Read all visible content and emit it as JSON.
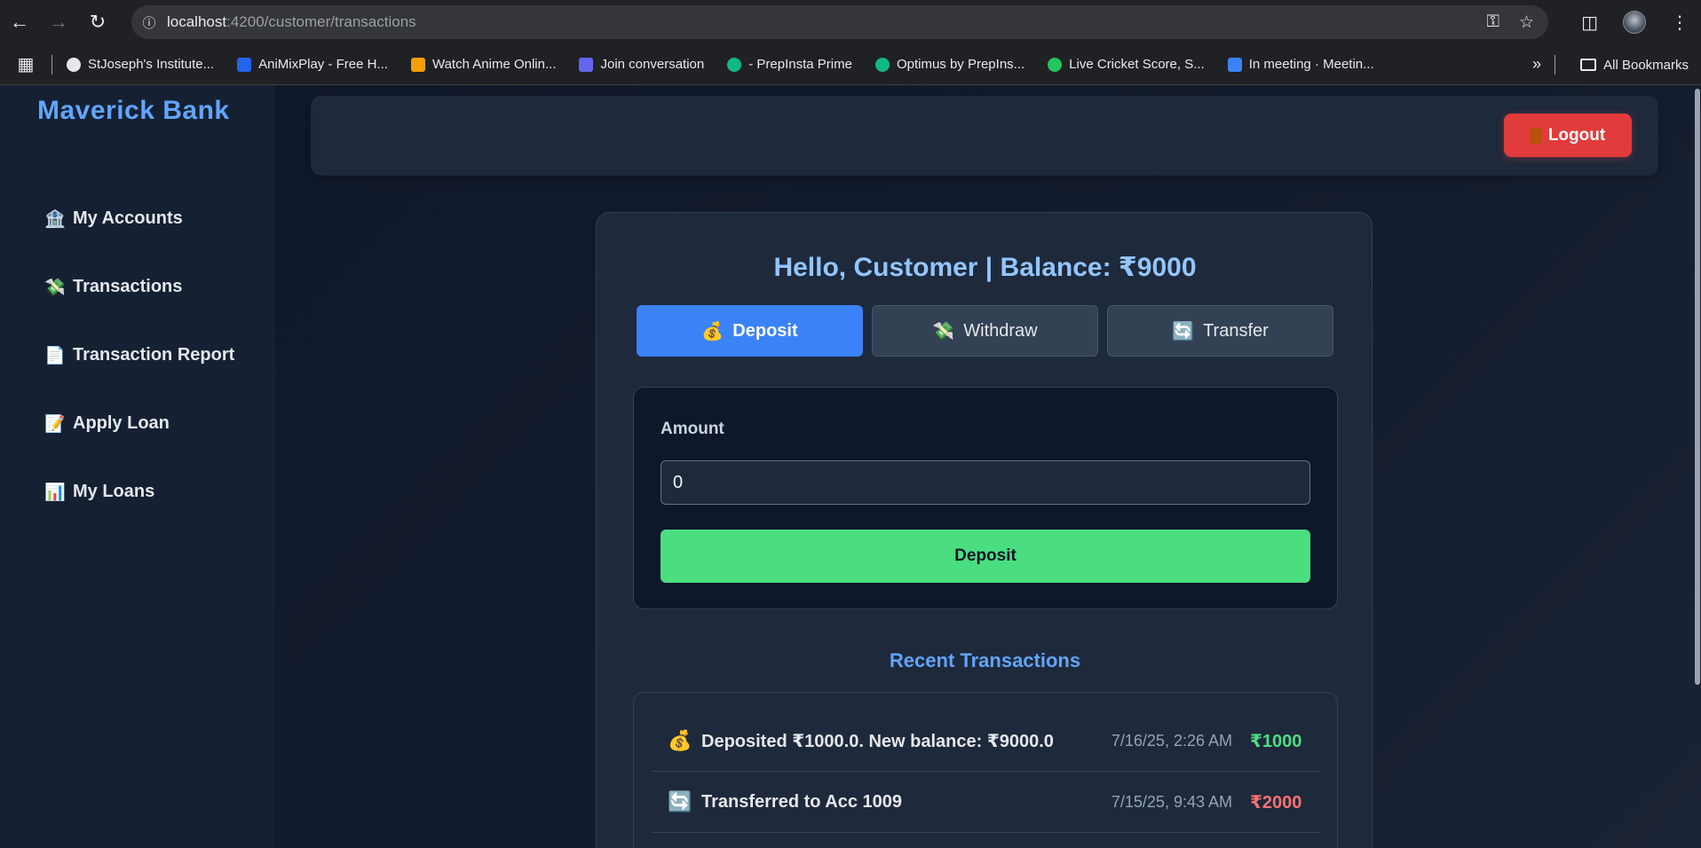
{
  "browser": {
    "url_host": "localhost",
    "url_path": ":4200/customer/transactions",
    "bookmarks": [
      {
        "label": "StJoseph's Institute...",
        "color": "#e5e7eb"
      },
      {
        "label": "AniMixPlay - Free H...",
        "color": "#2563eb"
      },
      {
        "label": "Watch Anime Onlin...",
        "color": "#f59e0b"
      },
      {
        "label": "Join conversation",
        "color": "#6366f1"
      },
      {
        "label": "- PrepInsta Prime",
        "color": "#10b981"
      },
      {
        "label": "Optimus by PrepIns...",
        "color": "#10b981"
      },
      {
        "label": "Live Cricket Score, S...",
        "color": "#22c55e"
      },
      {
        "label": "In meeting · Meetin...",
        "color": "#3b82f6"
      }
    ],
    "all_bookmarks": "All Bookmarks"
  },
  "sidebar": {
    "brand": "Maverick Bank",
    "items": [
      {
        "icon": "🏦",
        "label": "My Accounts"
      },
      {
        "icon": "💸",
        "label": "Transactions"
      },
      {
        "icon": "📄",
        "label": "Transaction Report"
      },
      {
        "icon": "📝",
        "label": "Apply Loan"
      },
      {
        "icon": "📊",
        "label": "My Loans"
      }
    ]
  },
  "topbar": {
    "logout_label": "Logout"
  },
  "main": {
    "greeting": "Hello, Customer | Balance: ₹9000",
    "tabs": [
      {
        "icon": "💰",
        "label": "Deposit",
        "active": true
      },
      {
        "icon": "💸",
        "label": "Withdraw",
        "active": false
      },
      {
        "icon": "🔄",
        "label": "Transfer",
        "active": false
      }
    ],
    "form": {
      "amount_label": "Amount",
      "amount_value": "0",
      "submit_label": "Deposit"
    },
    "recent_title": "Recent Transactions",
    "transactions": [
      {
        "icon": "💰",
        "description": "Deposited ₹1000.0. New balance: ₹9000.0",
        "date": "7/16/25, 2:26 AM",
        "amount": "₹1000",
        "type": "credit"
      },
      {
        "icon": "🔄",
        "description": "Transferred to Acc 1009",
        "date": "7/15/25, 9:43 AM",
        "amount": "₹2000",
        "type": "debit"
      }
    ]
  },
  "colors": {
    "accent": "#3b82f6",
    "brand": "#60a5fa",
    "success": "#4ade80",
    "danger": "#e23b3b"
  }
}
